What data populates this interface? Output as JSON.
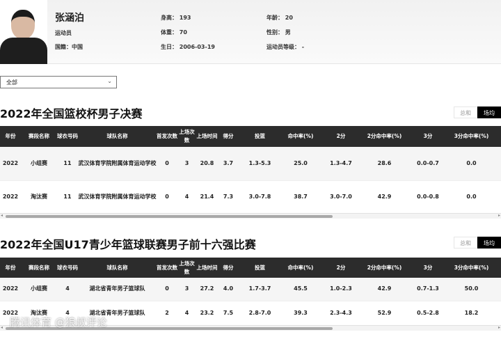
{
  "profile": {
    "name": "张涵泊",
    "role": "运动员",
    "nationality": "国籍：中国",
    "height": "身高：  193",
    "weight": "体重：  70",
    "birthday": "生日：  2006-03-19",
    "age": "年龄：  20",
    "gender": "性别：  男",
    "level": "运动员等级：  -"
  },
  "filter": {
    "selected": "全部"
  },
  "columns": [
    "年份",
    "赛段名称",
    "球衣号码",
    "球队名称",
    "首发次数",
    "上场次数",
    "上场时间",
    "得分",
    "投篮",
    "命中率(%)",
    "2分",
    "2分命中率(%)",
    "3分",
    "3分命中率(%)"
  ],
  "toggle": {
    "total": "总和",
    "avg": "场均",
    "active": "场均"
  },
  "sections": [
    {
      "title": "2022年全国篮校杯男子决赛",
      "rows": [
        [
          "2022",
          "小组赛",
          "11",
          "武汉体育学院附属体育运动学校",
          "0",
          "3",
          "20.8",
          "3.7",
          "1.3-5.3",
          "25.0",
          "1.3-4.7",
          "28.6",
          "0.0-0.7",
          "0.0"
        ],
        [
          "2022",
          "淘汰赛",
          "11",
          "武汉体育学院附属体育运动学校",
          "0",
          "4",
          "21.4",
          "7.3",
          "3.0-7.8",
          "38.7",
          "3.0-7.0",
          "42.9",
          "0.0-0.8",
          "0.0"
        ]
      ]
    },
    {
      "title": "2022年全国U17青少年篮球联赛男子前十六强比赛",
      "rows": [
        [
          "2022",
          "小组赛",
          "4",
          "湖北省青年男子篮球队",
          "0",
          "3",
          "27.2",
          "4.0",
          "1.7-3.7",
          "45.5",
          "1.0-2.3",
          "42.9",
          "0.7-1.3",
          "50.0"
        ],
        [
          "2022",
          "淘汰赛",
          "4",
          "湖北省青年男子篮球队",
          "2",
          "4",
          "23.2",
          "7.5",
          "2.8-7.0",
          "39.3",
          "2.3-4.3",
          "52.9",
          "0.5-2.8",
          "18.2"
        ]
      ]
    }
  ],
  "watermark": "腾讯体育 @狼叔评论"
}
